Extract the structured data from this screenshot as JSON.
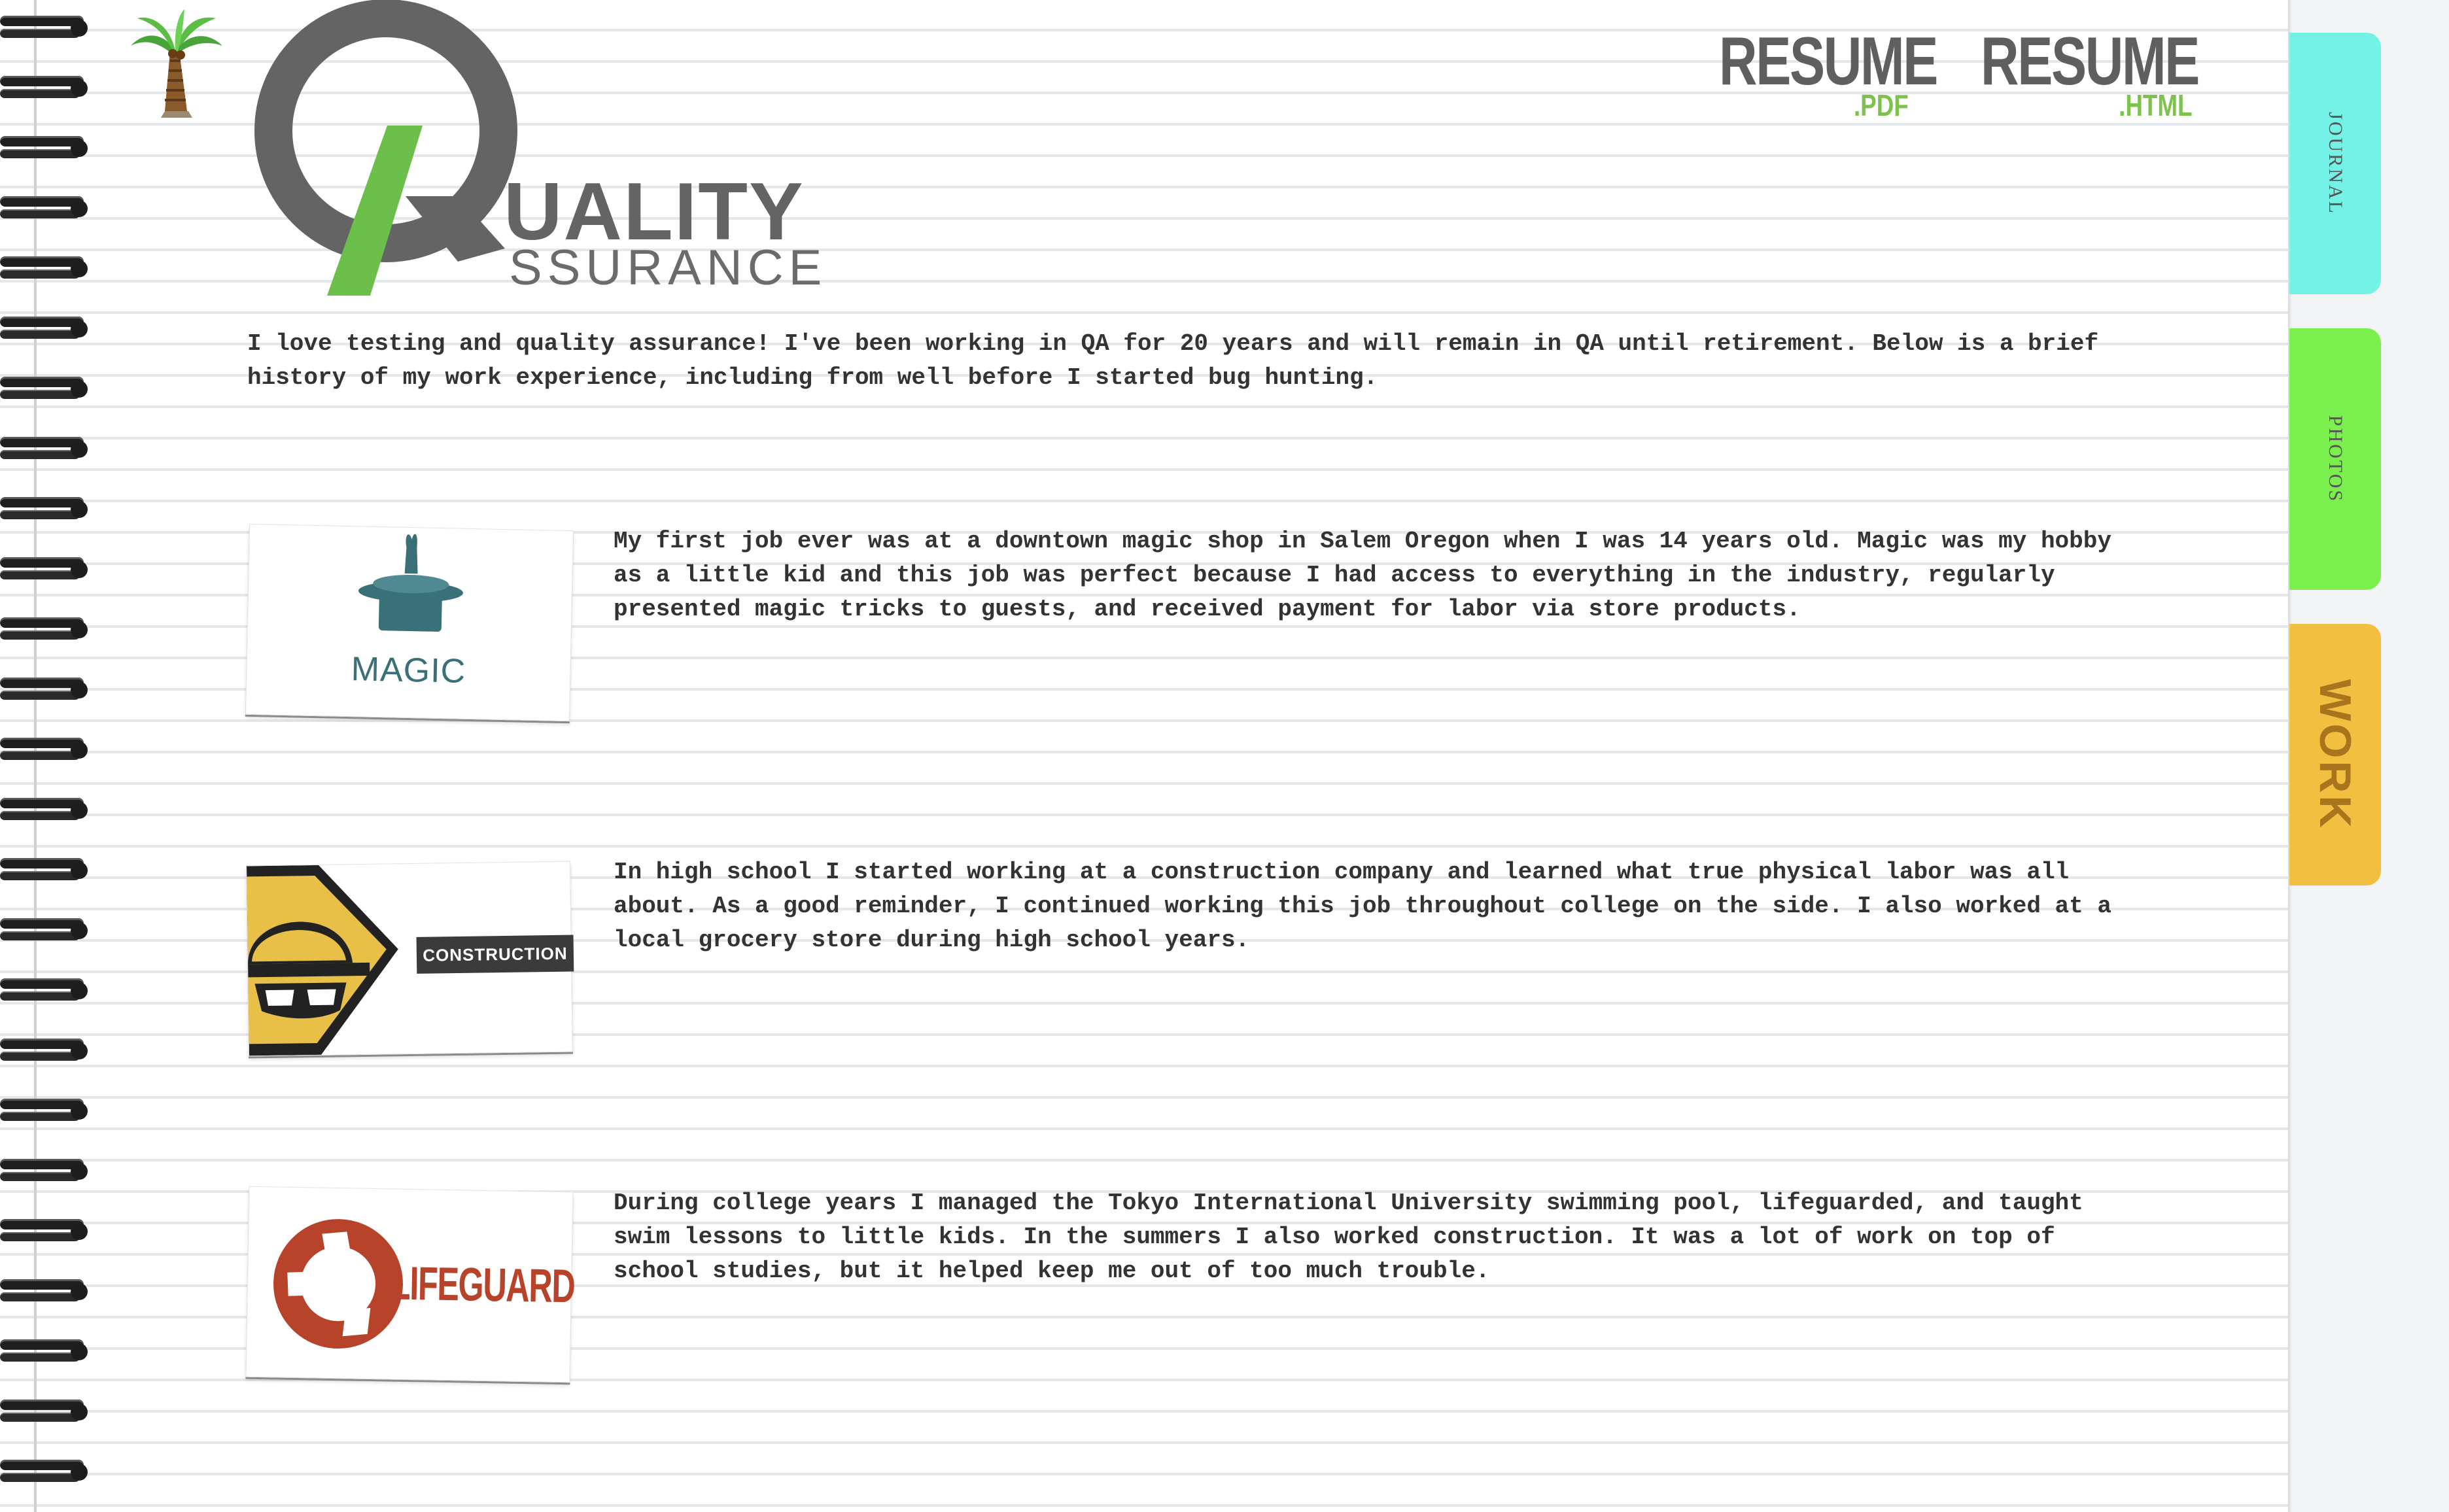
{
  "header": {
    "logo_line1": "UALITY",
    "logo_line2": "SSURANCE",
    "resume_pdf": {
      "big": "RESUME",
      "small": ".PDF"
    },
    "resume_html": {
      "big": "RESUME",
      "small": ".HTML"
    }
  },
  "tabs": [
    {
      "label": "JOURNAL",
      "color": "#74f2e6"
    },
    {
      "label": "PHOTOS",
      "color": "#7aef4e"
    },
    {
      "label": "WORK",
      "color": "#f3bf41"
    }
  ],
  "intro": "I love testing and quality assurance! I've been working in QA for 20 years and will remain in QA until retirement. Below is a brief history of my work experience, including from well before I started bug hunting.",
  "jobs": [
    {
      "card_label": "MAGIC",
      "text": "My first job ever was at a downtown magic shop in Salem Oregon when I was 14 years old. Magic was my hobby as a little kid and this job was perfect because I had access to everything in the industry, regularly presented magic tricks to guests, and received payment for labor via store products."
    },
    {
      "card_label": "CONSTRUCTION",
      "text": "In high school I started working at a construction company and learned what true physical labor was all about. As a good reminder, I continued working this job throughout college on the side. I also worked at a local grocery store during high school years."
    },
    {
      "card_label": "LIFEGUARD",
      "text": "During college years I managed the Tokyo International University swimming pool, lifeguarded, and taught swim lessons to little kids. In the summers I also worked construction. It was a lot of work on top of school studies, but it helped keep me out of too much trouble."
    }
  ],
  "colors": {
    "logo_gray": "#646464",
    "logo_green": "#6cbf4a",
    "magic_teal": "#3a7078",
    "construction_yellow": "#e8bf47",
    "lifeguard_red": "#b8432b"
  }
}
